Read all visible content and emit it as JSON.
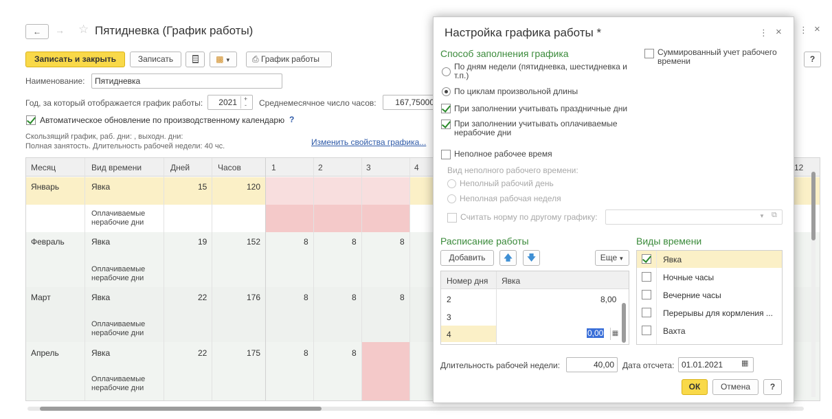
{
  "window": {
    "title": "Пятидневка (График работы)",
    "toolbar": {
      "save_close": "Записать и закрыть",
      "save": "Записать",
      "schedule": "График работы"
    },
    "name_label": "Наименование:",
    "name_value": "Пятидневка",
    "year_label": "Год, за который отображается график работы:",
    "year_value": "2021",
    "avg_hours_label": "Среднемесячное число часов:",
    "avg_hours_value": "167,75000",
    "auto_update_label": "Автоматическое обновление по производственному календарю",
    "auto_update_help": "?",
    "info_line1": "Скользящий график, раб. дни: , выходн. дни:",
    "info_line2": "Полная занятость. Длительность рабочей недели: 40 чс.",
    "change_props_link": "Изменить свойства графика...",
    "help_button": "?",
    "grid": {
      "headers": [
        "Месяц",
        "Вид времени",
        "Дней",
        "Часов",
        "1",
        "2",
        "3",
        "4"
      ],
      "last_header": "12",
      "rows": [
        {
          "month": "Январь",
          "kind": "Явка",
          "days": "15",
          "hours": "120",
          "d1": "",
          "d2": "",
          "d3": ""
        },
        {
          "month": "",
          "kind": "Оплачиваемые нерабочие дни",
          "days": "",
          "hours": "",
          "d1": "",
          "d2": "",
          "d3": ""
        },
        {
          "month": "Февраль",
          "kind": "Явка",
          "days": "19",
          "hours": "152",
          "d1": "8",
          "d2": "8",
          "d3": "8"
        },
        {
          "month": "",
          "kind": "Оплачиваемые нерабочие дни",
          "days": "",
          "hours": "",
          "d1": "",
          "d2": "",
          "d3": ""
        },
        {
          "month": "Март",
          "kind": "Явка",
          "days": "22",
          "hours": "176",
          "d1": "8",
          "d2": "8",
          "d3": "8"
        },
        {
          "month": "",
          "kind": "Оплачиваемые нерабочие дни",
          "days": "",
          "hours": "",
          "d1": "",
          "d2": "",
          "d3": ""
        },
        {
          "month": "Апрель",
          "kind": "Явка",
          "days": "22",
          "hours": "175",
          "d1": "8",
          "d2": "8",
          "d3": ""
        },
        {
          "month": "",
          "kind": "Оплачиваемые нерабочие дни",
          "days": "",
          "hours": "",
          "d1": "",
          "d2": "",
          "d3": ""
        }
      ]
    }
  },
  "dialog": {
    "title": "Настройка графика работы *",
    "fill_method_heading": "Способ заполнения графика",
    "summed_label": "Суммированный учет рабочего времени",
    "radio_weekdays": "По дням недели (пятидневка, шестидневка и т.п.)",
    "radio_cycles": "По циклам произвольной длины",
    "cb_holidays": "При заполнении учитывать праздничные дни",
    "cb_paid_nonwork": "При заполнении учитывать оплачиваемые нерабочие дни",
    "cb_parttime": "Неполное рабочее время",
    "parttime_kind_label": "Вид неполного рабочего времени:",
    "radio_partday": "Неполный рабочий день",
    "radio_partweek": "Неполная рабочая неделя",
    "cb_other_schedule": "Считать норму по другому графику:",
    "schedule_heading": "Расписание работы",
    "add_button": "Добавить",
    "more_button": "Еще",
    "schedule_table": {
      "headers": [
        "Номер дня",
        "Явка"
      ],
      "rows": [
        {
          "day": "2",
          "value": "8,00"
        },
        {
          "day": "3",
          "value": ""
        },
        {
          "day": "4",
          "value": "0,00"
        }
      ]
    },
    "time_kinds_heading": "Виды времени",
    "time_kinds": [
      {
        "label": "Явка",
        "checked": true
      },
      {
        "label": "Ночные часы",
        "checked": false
      },
      {
        "label": "Вечерние часы",
        "checked": false
      },
      {
        "label": "Перерывы для кормления ...",
        "checked": false
      },
      {
        "label": "Вахта",
        "checked": false
      }
    ],
    "week_length_label": "Длительность рабочей недели:",
    "week_length_value": "40,00",
    "ref_date_label": "Дата отсчета:",
    "ref_date_value": "01.01.2021",
    "ok_button": "ОК",
    "cancel_button": "Отмена",
    "help_button": "?"
  },
  "colors": {
    "accent_yellow": "#f9d949",
    "heading_green": "#3a8a3a",
    "holiday_pink": "#f4c9c9",
    "selected_row": "#fbf0c7"
  }
}
